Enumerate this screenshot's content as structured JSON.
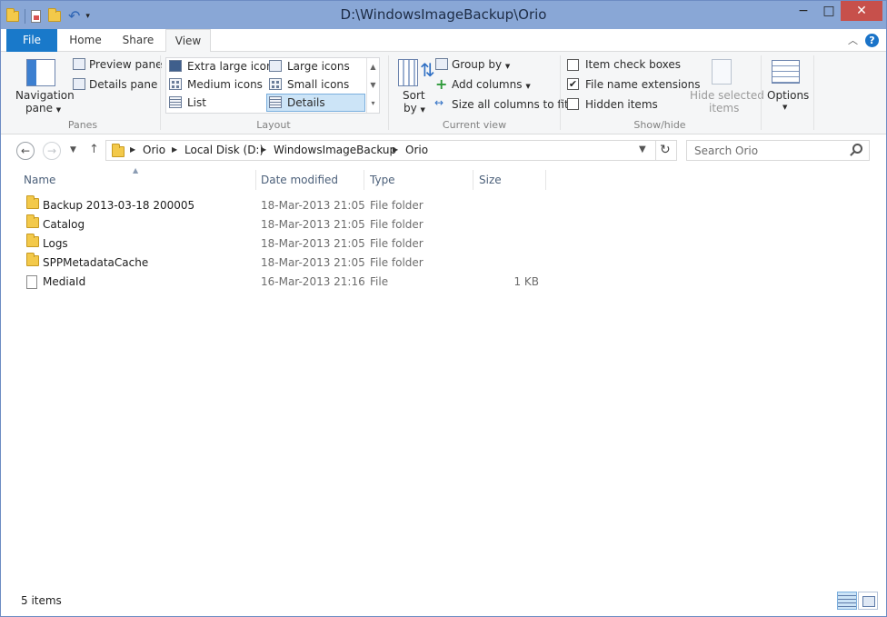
{
  "window": {
    "title": "D:\\WindowsImageBackup\\Orio"
  },
  "titlebar": {
    "minimize": "−",
    "maximize": "□",
    "close": "✕",
    "qat_dropdown": "▾"
  },
  "tabs": [
    {
      "label": "File"
    },
    {
      "label": "Home"
    },
    {
      "label": "Share"
    },
    {
      "label": "View"
    }
  ],
  "ribbon": {
    "panes": {
      "label": "Panes",
      "navigation_pane": "Navigation",
      "navigation_pane_2": "pane",
      "preview_pane": "Preview pane",
      "details_pane": "Details pane"
    },
    "layout": {
      "label": "Layout",
      "items": [
        "Extra large icons",
        "Large icons",
        "Medium icons",
        "Small icons",
        "List",
        "Details"
      ],
      "selected": "Details"
    },
    "current_view": {
      "label": "Current view",
      "sort_by": "Sort",
      "sort_by_2": "by",
      "group_by": "Group by",
      "add_columns": "Add columns",
      "size_all_columns": "Size all columns to fit"
    },
    "show_hide": {
      "label": "Show/hide",
      "item_check_boxes": "Item check boxes",
      "file_name_extensions": "File name extensions",
      "hidden_items": "Hidden items",
      "hide_selected": "Hide selected",
      "hide_selected_2": "items",
      "checks": {
        "item_check_boxes": false,
        "file_name_extensions": true,
        "hidden_items": false
      }
    },
    "options": {
      "label": "Options"
    }
  },
  "address": {
    "crumbs": [
      "Orio",
      "Local Disk (D:)",
      "WindowsImageBackup",
      "Orio"
    ]
  },
  "search": {
    "placeholder": "Search Orio"
  },
  "columns": {
    "name": "Name",
    "date": "Date modified",
    "type": "Type",
    "size": "Size"
  },
  "files": [
    {
      "name": "Backup 2013-03-18 200005",
      "date": "18-Mar-2013 21:05",
      "type": "File folder",
      "size": "",
      "icon": "folder-icon"
    },
    {
      "name": "Catalog",
      "date": "18-Mar-2013 21:05",
      "type": "File folder",
      "size": "",
      "icon": "folder-icon"
    },
    {
      "name": "Logs",
      "date": "18-Mar-2013 21:05",
      "type": "File folder",
      "size": "",
      "icon": "folder-icon"
    },
    {
      "name": "SPPMetadataCache",
      "date": "18-Mar-2013 21:05",
      "type": "File folder",
      "size": "",
      "icon": "folder-icon"
    },
    {
      "name": "MediaId",
      "date": "16-Mar-2013 21:16",
      "type": "File",
      "size": "1 KB",
      "icon": "file-icon"
    }
  ],
  "status": {
    "item_count": "5 items"
  },
  "colors": {
    "accent": "#1979ca",
    "titlebar": "#89a7d6",
    "close": "#c7504b",
    "selection": "#cce4f7"
  }
}
